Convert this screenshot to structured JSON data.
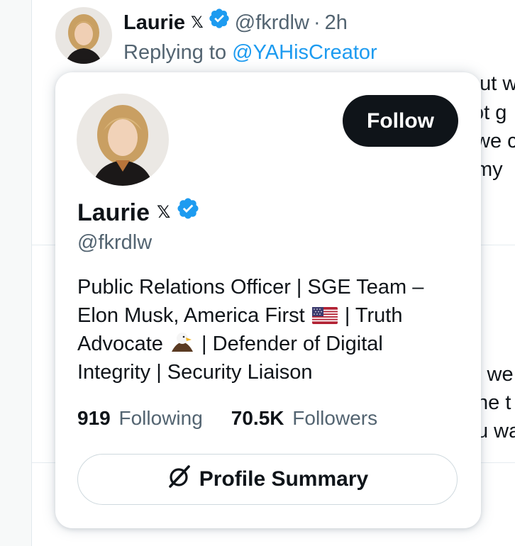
{
  "tweet": {
    "author_name": "Laurie",
    "x_badge": "𝕏",
    "handle": "@fkrdlw",
    "separator": "·",
    "time": "2h",
    "replying_prefix": "Replying to",
    "replying_to": "@YAHisCreator"
  },
  "background_text": {
    "line1": "but w",
    "line2": "ot g",
    "line3": "we c",
    "line4": "my",
    "line5": "s we",
    "line6": "he t",
    "line7": "u wa"
  },
  "hover_card": {
    "follow_label": "Follow",
    "name": "Laurie",
    "x_badge": "𝕏",
    "handle": "@fkrdlw",
    "bio": {
      "part1": "Public Relations Officer | SGE Team – Elon Musk, America First",
      "part2": "| Truth Advocate",
      "part3": "| Defender of Digital Integrity | Security Liaison"
    },
    "following_count": "919",
    "following_label": "Following",
    "followers_count": "70.5K",
    "followers_label": "Followers",
    "summary_label": "Profile Summary"
  },
  "colors": {
    "accent": "#1d9bf0",
    "text_primary": "#0f1419",
    "text_secondary": "#536471",
    "follow_bg": "#0f1419",
    "verified_badge": "#1d9bf0"
  },
  "icons": {
    "verified": "verified-badge-icon",
    "grok": "grok-icon",
    "flag": "us-flag-icon",
    "eagle": "eagle-icon"
  }
}
